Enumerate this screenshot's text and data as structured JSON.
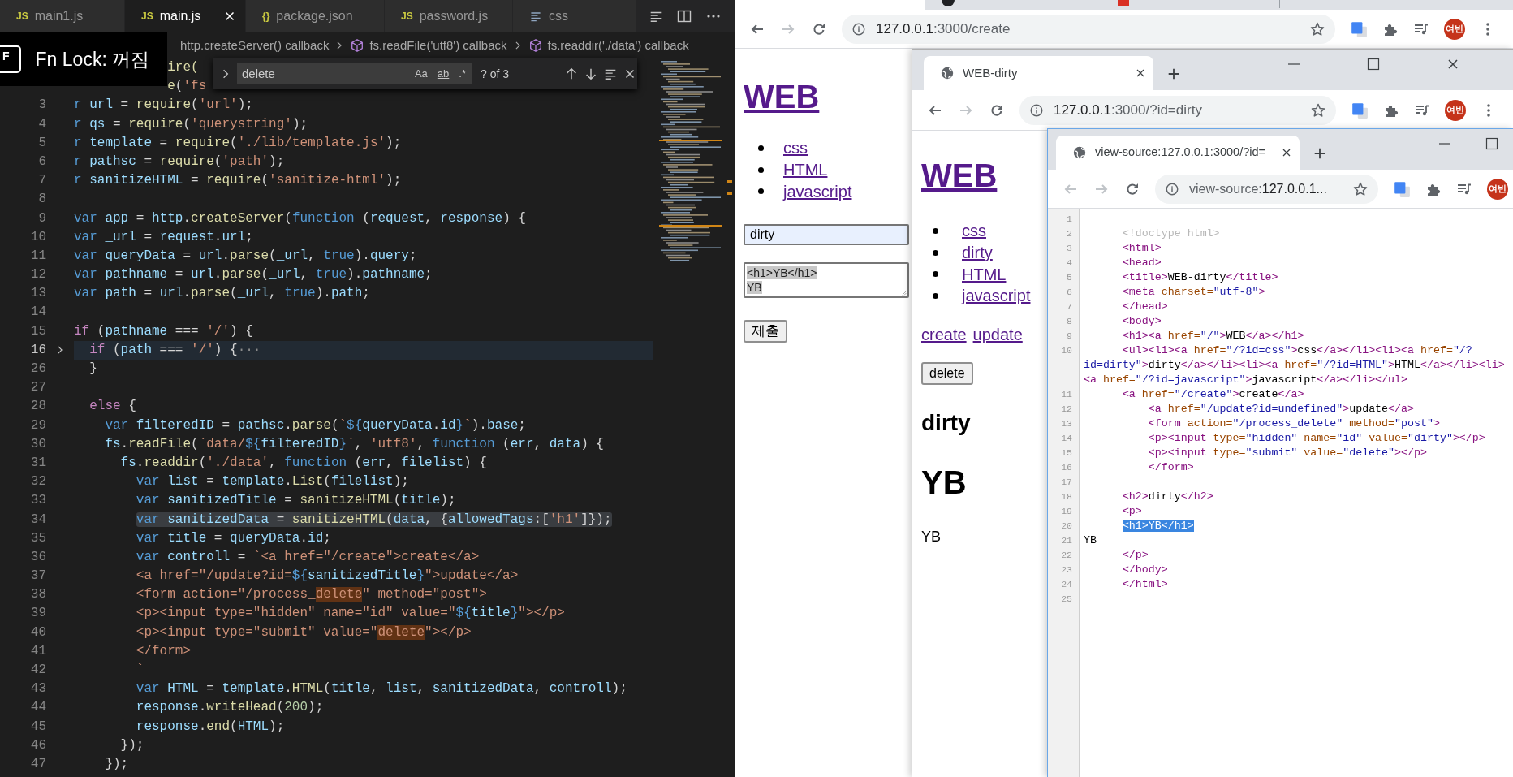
{
  "editor": {
    "tabs": [
      {
        "kind": "js",
        "icon_text": "JS",
        "label": "main1.js",
        "selected": false
      },
      {
        "kind": "js",
        "icon_text": "JS",
        "label": "main.js",
        "selected": true
      },
      {
        "kind": "json",
        "icon_text": "{}",
        "label": "package.json",
        "selected": false
      },
      {
        "kind": "js",
        "icon_text": "JS",
        "label": "password.js",
        "selected": false
      },
      {
        "kind": "css",
        "label": "css",
        "selected": false
      }
    ],
    "breadcrumbs": [
      "http.createServer() callback",
      "fs.readFile('utf8') callback",
      "fs.readdir('./data') callback"
    ],
    "notification": {
      "key": "F",
      "text": "Fn Lock: 꺼짐"
    },
    "find": {
      "value": "delete",
      "options": [
        {
          "label": "Aa",
          "on": false
        },
        {
          "label": "ab",
          "on": false
        },
        {
          "label": ".*",
          "on": false
        }
      ],
      "count": "? of 3"
    },
    "lines": [
      {
        "kind": "fragment",
        "t": [
          {
            "kind": "fn",
            "text": "ire("
          }
        ]
      },
      {
        "kind": "fragment",
        "t": [
          {
            "kind": "fn",
            "text": "e"
          },
          {
            "kind": "pl",
            "text": "("
          },
          {
            "kind": "str",
            "text": "'fs"
          }
        ]
      },
      {
        "n": "3",
        "kind": "plain",
        "t": [
          {
            "kind": "kw",
            "text": "r "
          },
          {
            "kind": "var",
            "text": "url"
          },
          {
            "kind": "pl",
            "text": " = "
          },
          {
            "kind": "fn",
            "text": "require"
          },
          {
            "kind": "pl",
            "text": "("
          },
          {
            "kind": "str",
            "text": "'url'"
          },
          {
            "kind": "pl",
            "text": ");"
          }
        ]
      },
      {
        "n": "4",
        "kind": "plain",
        "t": [
          {
            "kind": "kw",
            "text": "r "
          },
          {
            "kind": "var",
            "text": "qs"
          },
          {
            "kind": "pl",
            "text": " = "
          },
          {
            "kind": "fn",
            "text": "require"
          },
          {
            "kind": "pl",
            "text": "("
          },
          {
            "kind": "str",
            "text": "'querystring'"
          },
          {
            "kind": "pl",
            "text": ");"
          }
        ]
      },
      {
        "n": "5",
        "kind": "plain",
        "t": [
          {
            "kind": "kw",
            "text": "r "
          },
          {
            "kind": "var",
            "text": "template"
          },
          {
            "kind": "pl",
            "text": " = "
          },
          {
            "kind": "fn",
            "text": "require"
          },
          {
            "kind": "pl",
            "text": "("
          },
          {
            "kind": "str",
            "text": "'./lib/template.js'"
          },
          {
            "kind": "pl",
            "text": ");"
          }
        ]
      },
      {
        "n": "6",
        "kind": "plain",
        "t": [
          {
            "kind": "kw",
            "text": "r "
          },
          {
            "kind": "var",
            "text": "pathsc"
          },
          {
            "kind": "pl",
            "text": " = "
          },
          {
            "kind": "fn",
            "text": "require"
          },
          {
            "kind": "pl",
            "text": "("
          },
          {
            "kind": "str",
            "text": "'path'"
          },
          {
            "kind": "pl",
            "text": ");"
          }
        ]
      },
      {
        "n": "7",
        "kind": "plain",
        "t": [
          {
            "kind": "kw",
            "text": "r "
          },
          {
            "kind": "var",
            "text": "sanitizeHTML"
          },
          {
            "kind": "pl",
            "text": " = "
          },
          {
            "kind": "fn",
            "text": "require"
          },
          {
            "kind": "pl",
            "text": "("
          },
          {
            "kind": "str",
            "text": "'sanitize-html'"
          },
          {
            "kind": "pl",
            "text": ");"
          }
        ]
      },
      {
        "n": "8",
        "kind": "plain"
      },
      {
        "n": "9",
        "kind": "plain",
        "t": [
          {
            "kind": "kw",
            "text": "var "
          },
          {
            "kind": "var",
            "text": "app"
          },
          {
            "kind": "pl",
            "text": " = "
          },
          {
            "kind": "var",
            "text": "http"
          },
          {
            "kind": "pl",
            "text": "."
          },
          {
            "kind": "fn",
            "text": "createServer"
          },
          {
            "kind": "pl",
            "text": "("
          },
          {
            "kind": "kw",
            "text": "function"
          },
          {
            "kind": "pl",
            "text": " ("
          },
          {
            "kind": "var",
            "text": "request"
          },
          {
            "kind": "pl",
            "text": ", "
          },
          {
            "kind": "var",
            "text": "response"
          },
          {
            "kind": "pl",
            "text": ") {"
          }
        ]
      },
      {
        "n": "10",
        "kind": "plain",
        "t": [
          {
            "kind": "kw",
            "text": "var "
          },
          {
            "kind": "var",
            "text": "_url"
          },
          {
            "kind": "pl",
            "text": " = "
          },
          {
            "kind": "var",
            "text": "request"
          },
          {
            "kind": "pl",
            "text": "."
          },
          {
            "kind": "var",
            "text": "url"
          },
          {
            "kind": "pl",
            "text": ";"
          }
        ]
      },
      {
        "n": "11",
        "kind": "plain",
        "t": [
          {
            "kind": "kw",
            "text": "var "
          },
          {
            "kind": "var",
            "text": "queryData"
          },
          {
            "kind": "pl",
            "text": " = "
          },
          {
            "kind": "var",
            "text": "url"
          },
          {
            "kind": "pl",
            "text": "."
          },
          {
            "kind": "fn",
            "text": "parse"
          },
          {
            "kind": "pl",
            "text": "("
          },
          {
            "kind": "var",
            "text": "_url"
          },
          {
            "kind": "pl",
            "text": ", "
          },
          {
            "kind": "kw",
            "text": "true"
          },
          {
            "kind": "pl",
            "text": ")."
          },
          {
            "kind": "var",
            "text": "query"
          },
          {
            "kind": "pl",
            "text": ";"
          }
        ]
      },
      {
        "n": "12",
        "kind": "plain",
        "t": [
          {
            "kind": "kw",
            "text": "var "
          },
          {
            "kind": "var",
            "text": "pathname"
          },
          {
            "kind": "pl",
            "text": " = "
          },
          {
            "kind": "var",
            "text": "url"
          },
          {
            "kind": "pl",
            "text": "."
          },
          {
            "kind": "fn",
            "text": "parse"
          },
          {
            "kind": "pl",
            "text": "("
          },
          {
            "kind": "var",
            "text": "_url"
          },
          {
            "kind": "pl",
            "text": ", "
          },
          {
            "kind": "kw",
            "text": "true"
          },
          {
            "kind": "pl",
            "text": ")."
          },
          {
            "kind": "var",
            "text": "pathname"
          },
          {
            "kind": "pl",
            "text": ";"
          }
        ]
      },
      {
        "n": "13",
        "kind": "plain",
        "t": [
          {
            "kind": "kw",
            "text": "var "
          },
          {
            "kind": "var",
            "text": "path"
          },
          {
            "kind": "pl",
            "text": " = "
          },
          {
            "kind": "var",
            "text": "url"
          },
          {
            "kind": "pl",
            "text": "."
          },
          {
            "kind": "fn",
            "text": "parse"
          },
          {
            "kind": "pl",
            "text": "("
          },
          {
            "kind": "var",
            "text": "_url"
          },
          {
            "kind": "pl",
            "text": ", "
          },
          {
            "kind": "kw",
            "text": "true"
          },
          {
            "kind": "pl",
            "text": ")."
          },
          {
            "kind": "var",
            "text": "path"
          },
          {
            "kind": "pl",
            "text": ";"
          }
        ]
      },
      {
        "n": "14",
        "kind": "plain"
      },
      {
        "n": "15",
        "kind": "plain",
        "t": [
          {
            "kind": "ctl",
            "text": "if"
          },
          {
            "kind": "pl",
            "text": " ("
          },
          {
            "kind": "var",
            "text": "pathname"
          },
          {
            "kind": "pl",
            "text": " === "
          },
          {
            "kind": "str",
            "text": "'/'"
          },
          {
            "kind": "pl",
            "text": ") {"
          }
        ]
      },
      {
        "n": "16",
        "kind": "folded",
        "t": [
          {
            "kind": "ctl",
            "text": "  if"
          },
          {
            "kind": "pl",
            "text": " ("
          },
          {
            "kind": "var",
            "text": "path"
          },
          {
            "kind": "pl",
            "text": " === "
          },
          {
            "kind": "str",
            "text": "'/'"
          },
          {
            "kind": "pl",
            "text": ") {"
          },
          {
            "kind": "fold",
            "text": "···"
          }
        ]
      },
      {
        "n": "26",
        "kind": "plain",
        "t": [
          {
            "kind": "pl",
            "text": "  }"
          }
        ]
      },
      {
        "n": "27",
        "kind": "plain"
      },
      {
        "n": "28",
        "kind": "plain",
        "t": [
          {
            "kind": "ctl",
            "text": "  else"
          },
          {
            "kind": "pl",
            "text": " {"
          }
        ]
      },
      {
        "n": "29",
        "kind": "plain",
        "t": [
          {
            "kind": "kw",
            "text": "    var "
          },
          {
            "kind": "var",
            "text": "filteredID"
          },
          {
            "kind": "pl",
            "text": " = "
          },
          {
            "kind": "var",
            "text": "pathsc"
          },
          {
            "kind": "pl",
            "text": "."
          },
          {
            "kind": "fn",
            "text": "parse"
          },
          {
            "kind": "pl",
            "text": "("
          },
          {
            "kind": "str",
            "text": "`"
          },
          {
            "kind": "kw",
            "text": "${"
          },
          {
            "kind": "var",
            "text": "queryData"
          },
          {
            "kind": "pl",
            "text": "."
          },
          {
            "kind": "var",
            "text": "id"
          },
          {
            "kind": "kw",
            "text": "}"
          },
          {
            "kind": "str",
            "text": "`"
          },
          {
            "kind": "pl",
            "text": ")."
          },
          {
            "kind": "var",
            "text": "base"
          },
          {
            "kind": "pl",
            "text": ";"
          }
        ]
      },
      {
        "n": "30",
        "kind": "plain",
        "t": [
          {
            "kind": "var",
            "text": "    fs"
          },
          {
            "kind": "pl",
            "text": "."
          },
          {
            "kind": "fn",
            "text": "readFile"
          },
          {
            "kind": "pl",
            "text": "("
          },
          {
            "kind": "str",
            "text": "`data/"
          },
          {
            "kind": "kw",
            "text": "${"
          },
          {
            "kind": "var",
            "text": "filteredID"
          },
          {
            "kind": "kw",
            "text": "}"
          },
          {
            "kind": "str",
            "text": "`"
          },
          {
            "kind": "pl",
            "text": ", "
          },
          {
            "kind": "str",
            "text": "'utf8'"
          },
          {
            "kind": "pl",
            "text": ", "
          },
          {
            "kind": "kw",
            "text": "function"
          },
          {
            "kind": "pl",
            "text": " ("
          },
          {
            "kind": "var",
            "text": "err"
          },
          {
            "kind": "pl",
            "text": ", "
          },
          {
            "kind": "var",
            "text": "data"
          },
          {
            "kind": "pl",
            "text": ") {"
          }
        ]
      },
      {
        "n": "31",
        "kind": "plain",
        "t": [
          {
            "kind": "var",
            "text": "      fs"
          },
          {
            "kind": "pl",
            "text": "."
          },
          {
            "kind": "fn",
            "text": "readdir"
          },
          {
            "kind": "pl",
            "text": "("
          },
          {
            "kind": "str",
            "text": "'./data'"
          },
          {
            "kind": "pl",
            "text": ", "
          },
          {
            "kind": "kw",
            "text": "function"
          },
          {
            "kind": "pl",
            "text": " ("
          },
          {
            "kind": "var",
            "text": "err"
          },
          {
            "kind": "pl",
            "text": ", "
          },
          {
            "kind": "var",
            "text": "filelist"
          },
          {
            "kind": "pl",
            "text": ") {"
          }
        ]
      },
      {
        "n": "32",
        "kind": "plain",
        "t": [
          {
            "kind": "kw",
            "text": "        var "
          },
          {
            "kind": "var",
            "text": "list"
          },
          {
            "kind": "pl",
            "text": " = "
          },
          {
            "kind": "var",
            "text": "template"
          },
          {
            "kind": "pl",
            "text": "."
          },
          {
            "kind": "fn",
            "text": "List"
          },
          {
            "kind": "pl",
            "text": "("
          },
          {
            "kind": "var",
            "text": "filelist"
          },
          {
            "kind": "pl",
            "text": ");"
          }
        ]
      },
      {
        "n": "33",
        "kind": "plain",
        "t": [
          {
            "kind": "kw",
            "text": "        var "
          },
          {
            "kind": "var",
            "text": "sanitizedTitle"
          },
          {
            "kind": "pl",
            "text": " = "
          },
          {
            "kind": "fn",
            "text": "sanitizeHTML"
          },
          {
            "kind": "pl",
            "text": "("
          },
          {
            "kind": "var",
            "text": "title"
          },
          {
            "kind": "pl",
            "text": ");"
          }
        ]
      },
      {
        "n": "34",
        "kind": "selection",
        "t": [
          {
            "kind": "kw",
            "text": "        var "
          },
          {
            "kind": "var",
            "text": "sanitizedData"
          },
          {
            "kind": "pl",
            "text": " = "
          },
          {
            "kind": "fn",
            "text": "sanitizeHTML"
          },
          {
            "kind": "pl",
            "text": "("
          },
          {
            "kind": "var",
            "text": "data"
          },
          {
            "kind": "pl",
            "text": ", {"
          },
          {
            "kind": "var",
            "text": "allowedTags"
          },
          {
            "kind": "pl",
            "text": ":["
          },
          {
            "kind": "str",
            "text": "'h1'"
          },
          {
            "kind": "pl",
            "text": "]});"
          }
        ]
      },
      {
        "n": "35",
        "kind": "plain",
        "t": [
          {
            "kind": "kw",
            "text": "        var "
          },
          {
            "kind": "var",
            "text": "title"
          },
          {
            "kind": "pl",
            "text": " = "
          },
          {
            "kind": "var",
            "text": "queryData"
          },
          {
            "kind": "pl",
            "text": "."
          },
          {
            "kind": "var",
            "text": "id"
          },
          {
            "kind": "pl",
            "text": ";"
          }
        ]
      },
      {
        "n": "36",
        "kind": "plain",
        "t": [
          {
            "kind": "kw",
            "text": "        var "
          },
          {
            "kind": "var",
            "text": "controll"
          },
          {
            "kind": "pl",
            "text": " = "
          },
          {
            "kind": "str",
            "text": "`<a href=\"/create\">create</a>"
          }
        ]
      },
      {
        "n": "37",
        "kind": "plain",
        "t": [
          {
            "kind": "str",
            "text": "        <a href=\"/update?id="
          },
          {
            "kind": "kw",
            "text": "${"
          },
          {
            "kind": "var",
            "text": "sanitizedTitle"
          },
          {
            "kind": "kw",
            "text": "}"
          },
          {
            "kind": "str",
            "text": "\">update</a>"
          }
        ]
      },
      {
        "n": "38",
        "kind": "plain",
        "t": [
          {
            "kind": "str",
            "text": "        <form action=\"/process_"
          },
          {
            "kind": "match",
            "text": "delete"
          },
          {
            "kind": "str",
            "text": "\" method=\"post\">"
          }
        ]
      },
      {
        "n": "39",
        "kind": "plain",
        "t": [
          {
            "kind": "str",
            "text": "        <p><input type=\"hidden\" name=\"id\" value=\""
          },
          {
            "kind": "kw",
            "text": "${"
          },
          {
            "kind": "var",
            "text": "title"
          },
          {
            "kind": "kw",
            "text": "}"
          },
          {
            "kind": "str",
            "text": "\"></p>"
          }
        ]
      },
      {
        "n": "40",
        "kind": "plain",
        "t": [
          {
            "kind": "str",
            "text": "        <p><input type=\"submit\" value=\""
          },
          {
            "kind": "match",
            "text": "delete"
          },
          {
            "kind": "str",
            "text": "\"></p>"
          }
        ]
      },
      {
        "n": "41",
        "kind": "plain",
        "t": [
          {
            "kind": "str",
            "text": "        </form>"
          }
        ]
      },
      {
        "n": "42",
        "kind": "plain",
        "t": [
          {
            "kind": "str",
            "text": "        `"
          }
        ]
      },
      {
        "n": "43",
        "kind": "plain",
        "t": [
          {
            "kind": "kw",
            "text": "        var "
          },
          {
            "kind": "var",
            "text": "HTML"
          },
          {
            "kind": "pl",
            "text": " = "
          },
          {
            "kind": "var",
            "text": "template"
          },
          {
            "kind": "pl",
            "text": "."
          },
          {
            "kind": "fn",
            "text": "HTML"
          },
          {
            "kind": "pl",
            "text": "("
          },
          {
            "kind": "var",
            "text": "title"
          },
          {
            "kind": "pl",
            "text": ", "
          },
          {
            "kind": "var",
            "text": "list"
          },
          {
            "kind": "pl",
            "text": ", "
          },
          {
            "kind": "var",
            "text": "sanitizedData"
          },
          {
            "kind": "pl",
            "text": ", "
          },
          {
            "kind": "var",
            "text": "controll"
          },
          {
            "kind": "pl",
            "text": ");"
          }
        ]
      },
      {
        "n": "44",
        "kind": "plain",
        "t": [
          {
            "kind": "var",
            "text": "        response"
          },
          {
            "kind": "pl",
            "text": "."
          },
          {
            "kind": "fn",
            "text": "writeHead"
          },
          {
            "kind": "pl",
            "text": "("
          },
          {
            "kind": "num",
            "text": "200"
          },
          {
            "kind": "pl",
            "text": ");"
          }
        ]
      },
      {
        "n": "45",
        "kind": "plain",
        "t": [
          {
            "kind": "var",
            "text": "        response"
          },
          {
            "kind": "pl",
            "text": "."
          },
          {
            "kind": "fn",
            "text": "end"
          },
          {
            "kind": "pl",
            "text": "("
          },
          {
            "kind": "var",
            "text": "HTML"
          },
          {
            "kind": "pl",
            "text": ");"
          }
        ]
      },
      {
        "n": "46",
        "kind": "plain",
        "t": [
          {
            "kind": "pl",
            "text": "      });"
          }
        ]
      },
      {
        "n": "47",
        "kind": "plain",
        "t": [
          {
            "kind": "pl",
            "text": "    });"
          }
        ]
      }
    ]
  },
  "create_window": {
    "back_enabled": true,
    "forward_enabled": false,
    "url": [
      {
        "kind": "host",
        "text": "127.0.0.1"
      },
      {
        "kind": "dim",
        "text": ":3000/create"
      }
    ],
    "avatar": "여빈",
    "page": {
      "heading": "WEB",
      "links": [
        "css",
        "HTML",
        "javascript"
      ],
      "title_field": {
        "value": "dirty",
        "autofilled": true
      },
      "description_field": {
        "value": "<h1>YB</h1>\nYB",
        "selected": true
      },
      "submit": "제출"
    }
  },
  "page_window": {
    "tab_title": "WEB-dirty",
    "back_enabled": true,
    "forward_enabled": false,
    "url": [
      {
        "kind": "host",
        "text": "127.0.0.1"
      },
      {
        "kind": "dim",
        "text": ":3000/?id=dirty"
      }
    ],
    "avatar": "여빈",
    "page": {
      "heading": "WEB",
      "links": [
        "css",
        "dirty",
        "HTML",
        "javascript"
      ],
      "actions": [
        "create",
        "update"
      ],
      "delete_button": "delete",
      "title": "dirty",
      "content_heading": "YB",
      "content_text": "YB"
    }
  },
  "source_window": {
    "tab_title": "view-source:127.0.0.1:3000/?id=",
    "back_enabled": false,
    "forward_enabled": false,
    "url": [
      {
        "kind": "dim",
        "text": "view-source:"
      },
      {
        "kind": "host",
        "text": "127.0.0.1..."
      }
    ],
    "avatar": "여빈",
    "lines": [
      {
        "n": "1"
      },
      {
        "n": "2",
        "t": [
          {
            "kind": "doc",
            "text": "      <!doctype html>"
          }
        ]
      },
      {
        "n": "3",
        "t": [
          {
            "kind": "tag",
            "text": "      <html>"
          }
        ]
      },
      {
        "n": "4",
        "t": [
          {
            "kind": "tag",
            "text": "      <head>"
          }
        ]
      },
      {
        "n": "5",
        "t": [
          {
            "kind": "tag",
            "text": "      <title>"
          },
          {
            "kind": "txt",
            "text": "WEB-dirty"
          },
          {
            "kind": "tag",
            "text": "</title>"
          }
        ]
      },
      {
        "n": "6",
        "t": [
          {
            "kind": "tag",
            "text": "      <meta "
          },
          {
            "kind": "attr",
            "text": "charset="
          },
          {
            "kind": "val",
            "text": "\"utf-8\""
          },
          {
            "kind": "tag",
            "text": ">"
          }
        ]
      },
      {
        "n": "7",
        "t": [
          {
            "kind": "tag",
            "text": "      </head>"
          }
        ]
      },
      {
        "n": "8",
        "t": [
          {
            "kind": "tag",
            "text": "      <body>"
          }
        ]
      },
      {
        "n": "9",
        "t": [
          {
            "kind": "tag",
            "text": "      <h1><a "
          },
          {
            "kind": "attr",
            "text": "href="
          },
          {
            "kind": "val",
            "text": "\"/\""
          },
          {
            "kind": "tag",
            "text": ">"
          },
          {
            "kind": "txt",
            "text": "WEB"
          },
          {
            "kind": "tag",
            "text": "</a></h1>"
          }
        ]
      },
      {
        "n": "10",
        "t": [
          {
            "kind": "tag",
            "text": "      <ul><li><a "
          },
          {
            "kind": "attr",
            "text": "href="
          },
          {
            "kind": "val",
            "text": "\"/?id=css\""
          },
          {
            "kind": "tag",
            "text": ">"
          },
          {
            "kind": "txt",
            "text": "css"
          },
          {
            "kind": "tag",
            "text": "</a></li><li><a "
          },
          {
            "kind": "attr",
            "text": "href="
          },
          {
            "kind": "val",
            "text": "\"/?id=dirty\""
          },
          {
            "kind": "tag",
            "text": ">"
          },
          {
            "kind": "txt",
            "text": "dirty"
          },
          {
            "kind": "tag",
            "text": "</a></li><li><a "
          },
          {
            "kind": "attr",
            "text": "href="
          },
          {
            "kind": "val",
            "text": "\"/?id=HTML\""
          },
          {
            "kind": "tag",
            "text": ">"
          },
          {
            "kind": "txt",
            "text": "HTML"
          },
          {
            "kind": "tag",
            "text": "</a></li><li><a "
          },
          {
            "kind": "attr",
            "text": "href="
          },
          {
            "kind": "val",
            "text": "\"/?id=javascript\""
          },
          {
            "kind": "tag",
            "text": ">"
          },
          {
            "kind": "txt",
            "text": "javascript"
          },
          {
            "kind": "tag",
            "text": "</a></li></ul>"
          }
        ]
      },
      {
        "n": "11",
        "t": [
          {
            "kind": "tag",
            "text": "      <a "
          },
          {
            "kind": "attr",
            "text": "href="
          },
          {
            "kind": "val",
            "text": "\"/create\""
          },
          {
            "kind": "tag",
            "text": ">"
          },
          {
            "kind": "txt",
            "text": "create"
          },
          {
            "kind": "tag",
            "text": "</a>"
          }
        ]
      },
      {
        "n": "12",
        "t": [
          {
            "kind": "tag",
            "text": "          <a "
          },
          {
            "kind": "attr",
            "text": "href="
          },
          {
            "kind": "val",
            "text": "\"/update?id=undefined\""
          },
          {
            "kind": "tag",
            "text": ">"
          },
          {
            "kind": "txt",
            "text": "update"
          },
          {
            "kind": "tag",
            "text": "</a>"
          }
        ]
      },
      {
        "n": "13",
        "t": [
          {
            "kind": "tag",
            "text": "          <form "
          },
          {
            "kind": "attr",
            "text": "action="
          },
          {
            "kind": "val",
            "text": "\"/process_delete\""
          },
          {
            "kind": "attr",
            "text": " method="
          },
          {
            "kind": "val",
            "text": "\"post\""
          },
          {
            "kind": "tag",
            "text": ">"
          }
        ]
      },
      {
        "n": "14",
        "t": [
          {
            "kind": "tag",
            "text": "          <p><input "
          },
          {
            "kind": "attr",
            "text": "type="
          },
          {
            "kind": "val",
            "text": "\"hidden\""
          },
          {
            "kind": "attr",
            "text": " name="
          },
          {
            "kind": "val",
            "text": "\"id\""
          },
          {
            "kind": "attr",
            "text": " value="
          },
          {
            "kind": "val",
            "text": "\"dirty\""
          },
          {
            "kind": "tag",
            "text": "></p>"
          }
        ]
      },
      {
        "n": "15",
        "t": [
          {
            "kind": "tag",
            "text": "          <p><input "
          },
          {
            "kind": "attr",
            "text": "type="
          },
          {
            "kind": "val",
            "text": "\"submit\""
          },
          {
            "kind": "attr",
            "text": " value="
          },
          {
            "kind": "val",
            "text": "\"delete\""
          },
          {
            "kind": "tag",
            "text": "></p>"
          }
        ]
      },
      {
        "n": "16",
        "t": [
          {
            "kind": "tag",
            "text": "          </form>"
          }
        ]
      },
      {
        "n": "17"
      },
      {
        "n": "18",
        "t": [
          {
            "kind": "tag",
            "text": "      <h2>"
          },
          {
            "kind": "txt",
            "text": "dirty"
          },
          {
            "kind": "tag",
            "text": "</h2>"
          }
        ]
      },
      {
        "n": "19",
        "t": [
          {
            "kind": "tag",
            "text": "      <p>"
          }
        ]
      },
      {
        "n": "20",
        "t": [
          {
            "kind": "sel",
            "text": "      <h1>YB</h1>"
          }
        ]
      },
      {
        "n": "21",
        "t": [
          {
            "kind": "txt",
            "text": "YB"
          }
        ]
      },
      {
        "n": "22",
        "t": [
          {
            "kind": "tag",
            "text": "      </p>"
          }
        ]
      },
      {
        "n": "23",
        "t": [
          {
            "kind": "tag",
            "text": "      </body>"
          }
        ]
      },
      {
        "n": "24",
        "t": [
          {
            "kind": "tag",
            "text": "      </html>"
          }
        ]
      },
      {
        "n": "25"
      }
    ]
  }
}
